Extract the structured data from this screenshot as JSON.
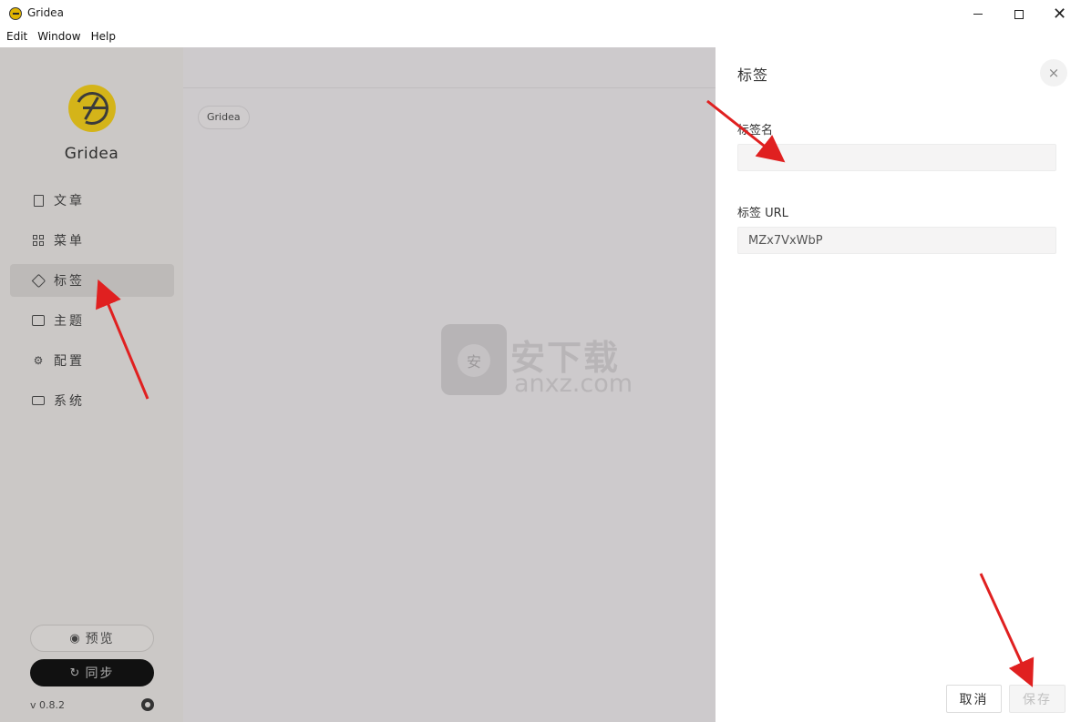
{
  "window": {
    "title": "Gridea",
    "minimize": "—",
    "maximize": "☐",
    "close": "✕"
  },
  "menubar": {
    "items": [
      "Edit",
      "Window",
      "Help"
    ]
  },
  "sidebar": {
    "brand": "Gridea",
    "items": [
      {
        "label": "文章",
        "icon": "document-icon"
      },
      {
        "label": "菜单",
        "icon": "grid-icon"
      },
      {
        "label": "标签",
        "icon": "tag-icon",
        "active": true
      },
      {
        "label": "主题",
        "icon": "image-icon"
      },
      {
        "label": "配置",
        "icon": "gear-icon"
      },
      {
        "label": "系统",
        "icon": "monitor-icon"
      }
    ],
    "preview_label": "预览",
    "sync_label": "同步",
    "version": "v 0.8.2"
  },
  "main": {
    "tags": [
      "Gridea"
    ],
    "watermark": {
      "text": "安下载",
      "sub": "anxz.com",
      "shield": "安"
    }
  },
  "panel": {
    "title": "标签",
    "close_label": "×",
    "name_label": "标签名",
    "name_value": "",
    "url_label": "标签 URL",
    "url_value": "MZx7VxWbP",
    "cancel_label": "取消",
    "save_label": "保存"
  },
  "colors": {
    "sidebar_bg": "#cbc8c6",
    "overlay_bg": "#cdcacc",
    "accent_logo": "#d4b419",
    "annotation_arrow": "#e02020"
  }
}
